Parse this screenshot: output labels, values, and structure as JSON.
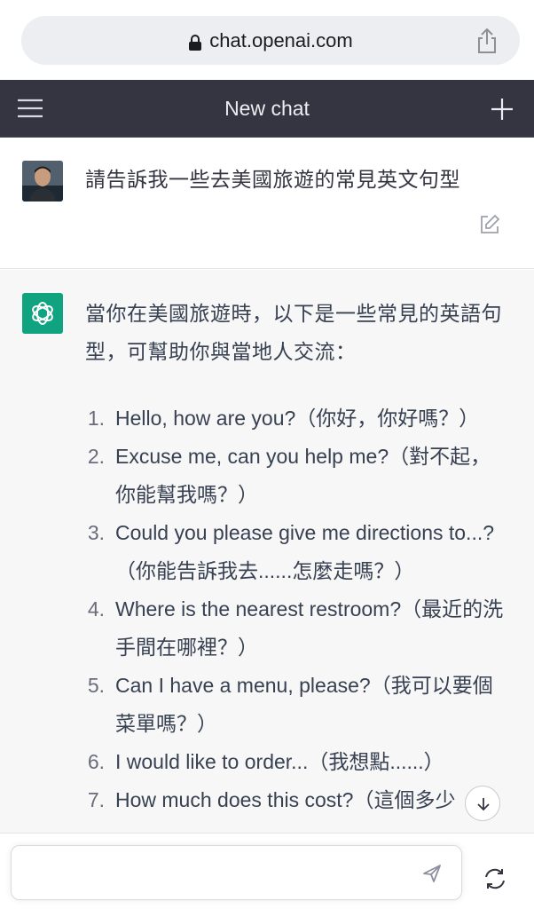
{
  "browser": {
    "url": "chat.openai.com"
  },
  "header": {
    "title": "New chat"
  },
  "user_message": {
    "text": "請告訴我一些去美國旅遊的常見英文句型"
  },
  "assistant_message": {
    "intro": "當你在美國旅遊時，以下是一些常見的英語句型，可幫助你與當地人交流：",
    "items": [
      {
        "num": "1.",
        "text": "Hello, how are you?（你好，你好嗎？）"
      },
      {
        "num": "2.",
        "text": "Excuse me, can you help me?（對不起，你能幫我嗎？）"
      },
      {
        "num": "3.",
        "text": "Could you please give me directions to...?（你能告訴我去......怎麼走嗎？）"
      },
      {
        "num": "4.",
        "text": "Where is the nearest restroom?（最近的洗手間在哪裡？）"
      },
      {
        "num": "5.",
        "text": "Can I have a menu, please?（我可以要個菜單嗎？）"
      },
      {
        "num": "6.",
        "text": "I would like to order...（我想點......）"
      },
      {
        "num": "7.",
        "text": "How much does this cost?（這個多少"
      }
    ]
  },
  "composer": {
    "placeholder": ""
  },
  "icons": {
    "lock": "lock-icon",
    "share": "share-icon",
    "menu": "hamburger-menu-icon",
    "new_chat": "plus-icon",
    "edit": "edit-icon",
    "assistant_logo": "openai-logo",
    "scroll": "arrow-down-icon",
    "send": "send-icon",
    "regenerate": "regenerate-icon"
  },
  "colors": {
    "header_bg": "#343541",
    "assistant_bg": "#f7f7f8",
    "brand": "#10a37f"
  }
}
